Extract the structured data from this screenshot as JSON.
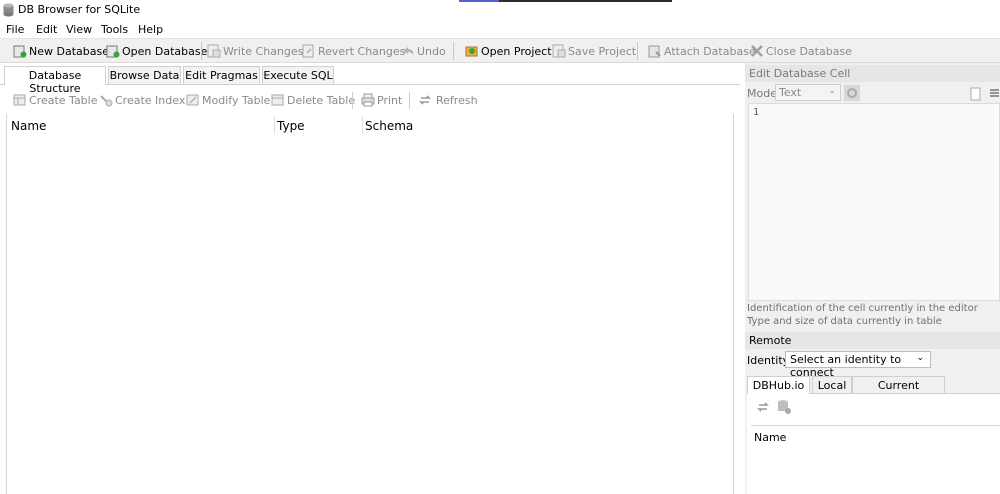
{
  "window": {
    "title": "DB Browser for SQLite"
  },
  "menu": [
    "File",
    "Edit",
    "View",
    "Tools",
    "Help"
  ],
  "toolbar": {
    "new_database": "New Database",
    "open_database": "Open Database",
    "write_changes": "Write Changes",
    "revert_changes": "Revert Changes",
    "undo": "Undo",
    "open_project": "Open Project",
    "save_project": "Save Project",
    "attach_database": "Attach Database",
    "close_database": "Close Database"
  },
  "tabs": [
    "Database Structure",
    "Browse Data",
    "Edit Pragmas",
    "Execute SQL"
  ],
  "structure_toolbar": {
    "create_table": "Create Table",
    "create_index": "Create Index",
    "modify_table": "Modify Table",
    "delete_table": "Delete Table",
    "print": "Print",
    "refresh": "Refresh"
  },
  "tree_headers": [
    "Name",
    "Type",
    "Schema"
  ],
  "edit_cell": {
    "title": "Edit Database Cell",
    "mode_label": "Mode:",
    "mode_value": "Text",
    "line_number": "1",
    "info_line1": "Identification of the cell currently in the editor",
    "info_line2": "Type and size of data currently in table"
  },
  "remote": {
    "title": "Remote",
    "identity_label": "Identity",
    "identity_value": "Select an identity to connect",
    "tabs": [
      "DBHub.io",
      "Local",
      "Current Database"
    ],
    "name_header": "Name"
  },
  "colors": {
    "toolbar_bg": "#f0f0f0",
    "disabled_text": "#8a8a8a"
  }
}
